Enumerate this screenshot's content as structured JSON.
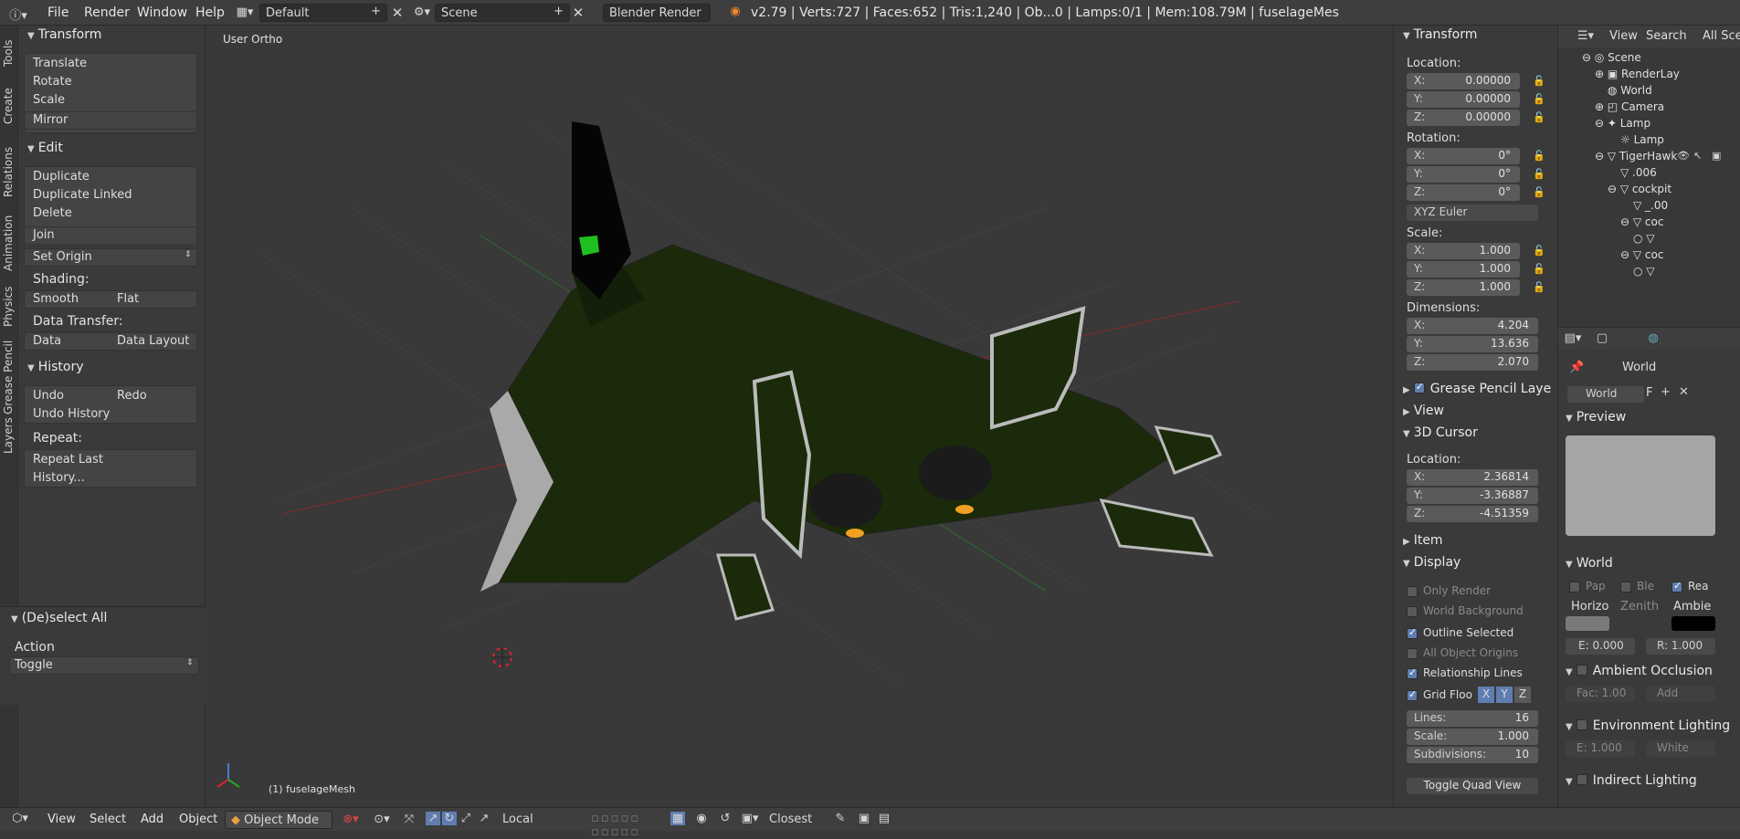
{
  "topbar": {
    "menus": [
      "File",
      "Render",
      "Window",
      "Help"
    ],
    "screen_layout": "Default",
    "scene": "Scene",
    "render_engine": "Blender Render",
    "stats": "v2.79 | Verts:727 | Faces:652 | Tris:1,240 | Ob...0 | Lamps:0/1 | Mem:108.79M | fuselageMes"
  },
  "side_tabs": [
    "Tools",
    "Create",
    "Relations",
    "Animation",
    "Physics",
    "Grease Pencil",
    "Layers"
  ],
  "toolshelf": {
    "transform": {
      "title": "Transform",
      "buttons": [
        "Translate",
        "Rotate",
        "Scale"
      ],
      "mirror": "Mirror"
    },
    "edit": {
      "title": "Edit",
      "buttons": [
        "Duplicate",
        "Duplicate Linked",
        "Delete"
      ],
      "join": "Join",
      "set_origin": "Set Origin",
      "shading_label": "Shading:",
      "smooth": "Smooth",
      "flat": "Flat",
      "data_transfer_label": "Data Transfer:",
      "data": "Data",
      "data_layout": "Data Layout"
    },
    "history": {
      "title": "History",
      "undo": "Undo",
      "redo": "Redo",
      "undo_history": "Undo History",
      "repeat_label": "Repeat:",
      "repeat_last": "Repeat Last",
      "history_btn": "History..."
    }
  },
  "operator": {
    "title": "(De)select All",
    "action_label": "Action",
    "action_value": "Toggle"
  },
  "viewport": {
    "view_label": "User Ortho",
    "object_label": "(1) fuselageMesh"
  },
  "n_panel": {
    "transform_title": "Transform",
    "location_label": "Location:",
    "location": [
      {
        "k": "X:",
        "v": "0.00000"
      },
      {
        "k": "Y:",
        "v": "0.00000"
      },
      {
        "k": "Z:",
        "v": "0.00000"
      }
    ],
    "rotation_label": "Rotation:",
    "rotation": [
      {
        "k": "X:",
        "v": "0°"
      },
      {
        "k": "Y:",
        "v": "0°"
      },
      {
        "k": "Z:",
        "v": "0°"
      }
    ],
    "rotation_mode": "XYZ Euler",
    "scale_label": "Scale:",
    "scale": [
      {
        "k": "X:",
        "v": "1.000"
      },
      {
        "k": "Y:",
        "v": "1.000"
      },
      {
        "k": "Z:",
        "v": "1.000"
      }
    ],
    "dimensions_label": "Dimensions:",
    "dimensions": [
      {
        "k": "X:",
        "v": "4.204"
      },
      {
        "k": "Y:",
        "v": "13.636"
      },
      {
        "k": "Z:",
        "v": "2.070"
      }
    ],
    "grease_pencil": "Grease Pencil Laye",
    "view": "View",
    "cursor_title": "3D Cursor",
    "cursor_location_label": "Location:",
    "cursor": [
      {
        "k": "X:",
        "v": "2.36814"
      },
      {
        "k": "Y:",
        "v": "-3.36887"
      },
      {
        "k": "Z:",
        "v": "-4.51359"
      }
    ],
    "item": "Item",
    "display_title": "Display",
    "only_render": "Only Render",
    "world_background": "World Background",
    "outline_selected": "Outline Selected",
    "all_object_origins": "All Object Origins",
    "relationship_lines": "Relationship Lines",
    "grid_floor": "Grid Floo",
    "axis_x": "X",
    "axis_y": "Y",
    "axis_z": "Z",
    "lines_label": "Lines:",
    "lines_value": "16",
    "scale_label2": "Scale:",
    "scale_value": "1.000",
    "subdivisions_label": "Subdivisions:",
    "subdivisions_value": "10",
    "toggle_quad": "Toggle Quad View"
  },
  "outliner": {
    "view": "View",
    "search": "Search",
    "all_scenes": "All Sce",
    "rows": [
      "Scene",
      "RenderLay",
      "World",
      "Camera",
      "Lamp",
      "Lamp",
      "TigerHawk",
      ".006",
      "cockpit",
      "_.00",
      "coc",
      "",
      "coc",
      ""
    ]
  },
  "properties": {
    "world_name": "World",
    "world_field": "World",
    "world_f": "F",
    "preview_title": "Preview",
    "world_title": "World",
    "paper": "Pap",
    "blend": "Ble",
    "real": "Rea",
    "horizon": "Horizo",
    "zenith": "Zenith",
    "ambient": "Ambie",
    "exposure": "E: 0.000",
    "range": "R: 1.000",
    "ao_title": "Ambient Occlusion",
    "ao_fac": "Fac: 1.00",
    "ao_add": "Add",
    "env_title": "Environment Lighting",
    "env_e": "E: 1.000",
    "env_white": "White",
    "indirect_title": "Indirect Lighting"
  },
  "bottombar": {
    "menus": [
      "View",
      "Select",
      "Add",
      "Object"
    ],
    "mode": "Object Mode",
    "pivot": "Local",
    "snap": "Closest"
  }
}
